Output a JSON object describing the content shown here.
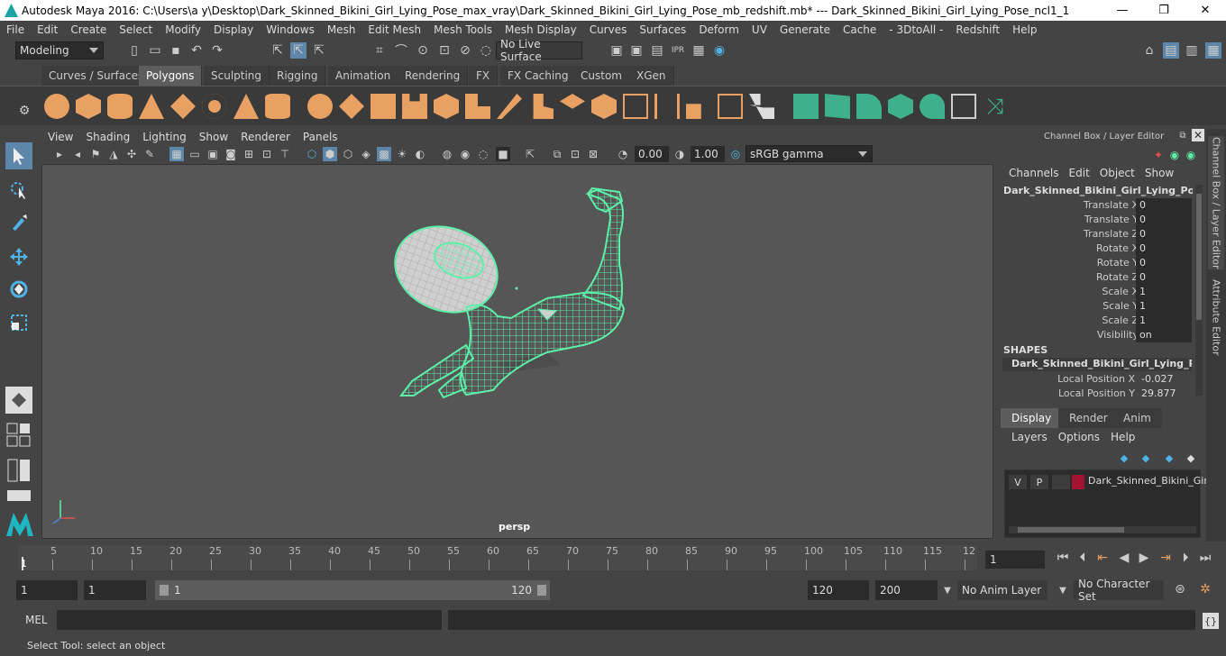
{
  "window": {
    "title": "Autodesk Maya 2016: C:\\Users\\a y\\Desktop\\Dark_Skinned_Bikini_Girl_Lying_Pose_max_vray\\Dark_Skinned_Bikini_Girl_Lying_Pose_mb_redshift.mb*   ---   Dark_Skinned_Bikini_Girl_Lying_Pose_ncl1_1"
  },
  "menubar": [
    "File",
    "Edit",
    "Create",
    "Select",
    "Modify",
    "Display",
    "Windows",
    "Mesh",
    "Edit Mesh",
    "Mesh Tools",
    "Mesh Display",
    "Curves",
    "Surfaces",
    "Deform",
    "UV",
    "Generate",
    "Cache",
    "- 3DtoAll -",
    "Redshift",
    "Help"
  ],
  "statusline": {
    "mode": "Modeling",
    "live_surface": "No Live Surface"
  },
  "shelf_tabs": [
    "Curves / Surfaces",
    "Polygons",
    "Sculpting",
    "Rigging",
    "Animation",
    "Rendering",
    "FX",
    "FX Caching",
    "Custom",
    "XGen"
  ],
  "shelf_active": "Polygons",
  "viewport": {
    "menu": [
      "View",
      "Shading",
      "Lighting",
      "Show",
      "Renderer",
      "Panels"
    ],
    "exposure": "0.00",
    "gamma": "1.00",
    "color_space": "sRGB gamma",
    "camera": "persp"
  },
  "channel_box": {
    "title": "Channel Box / Layer Editor",
    "menu": [
      "Channels",
      "Edit",
      "Object",
      "Show"
    ],
    "object_name": "Dark_Skinned_Bikini_Girl_Lying_Pose_...",
    "attributes": [
      {
        "label": "Translate X",
        "value": "0"
      },
      {
        "label": "Translate Y",
        "value": "0"
      },
      {
        "label": "Translate Z",
        "value": "0"
      },
      {
        "label": "Rotate X",
        "value": "0"
      },
      {
        "label": "Rotate Y",
        "value": "0"
      },
      {
        "label": "Rotate Z",
        "value": "0"
      },
      {
        "label": "Scale X",
        "value": "1"
      },
      {
        "label": "Scale Y",
        "value": "1"
      },
      {
        "label": "Scale Z",
        "value": "1"
      },
      {
        "label": "Visibility",
        "value": "on"
      }
    ],
    "shapes_label": "SHAPES",
    "shape_name": "Dark_Skinned_Bikini_Girl_Lying_Pos...",
    "shape_attributes": [
      {
        "label": "Local Position X",
        "value": "-0.027"
      },
      {
        "label": "Local Position Y",
        "value": "29.877"
      }
    ]
  },
  "layer_editor": {
    "tabs": [
      "Display",
      "Render",
      "Anim"
    ],
    "active_tab": "Display",
    "menu": [
      "Layers",
      "Options",
      "Help"
    ],
    "layer": {
      "v": "V",
      "p": "P",
      "name": "Dark_Skinned_Bikini_Gir",
      "color": "#a3122e"
    }
  },
  "side_tabs": [
    "Channel Box / Layer Editor",
    "Attribute Editor"
  ],
  "timeline": {
    "ticks": [
      "5",
      "10",
      "15",
      "20",
      "25",
      "30",
      "35",
      "40",
      "45",
      "50",
      "55",
      "60",
      "65",
      "70",
      "75",
      "80",
      "85",
      "90",
      "95",
      "100",
      "105",
      "110",
      "115",
      "12"
    ],
    "start_marker": "1",
    "current_frame": "1"
  },
  "range": {
    "start": "1",
    "playback_start": "1",
    "slider_start": "1",
    "slider_end": "120",
    "playback_end": "120",
    "end": "200",
    "anim_layer": "No Anim Layer",
    "character_set": "No Character Set"
  },
  "command": {
    "label": "MEL"
  },
  "helpline": "Select Tool: select an object",
  "colors": {
    "wire": "#5cf0a8",
    "accent_orange": "#e8a063",
    "accent_green": "#3fb08c"
  }
}
